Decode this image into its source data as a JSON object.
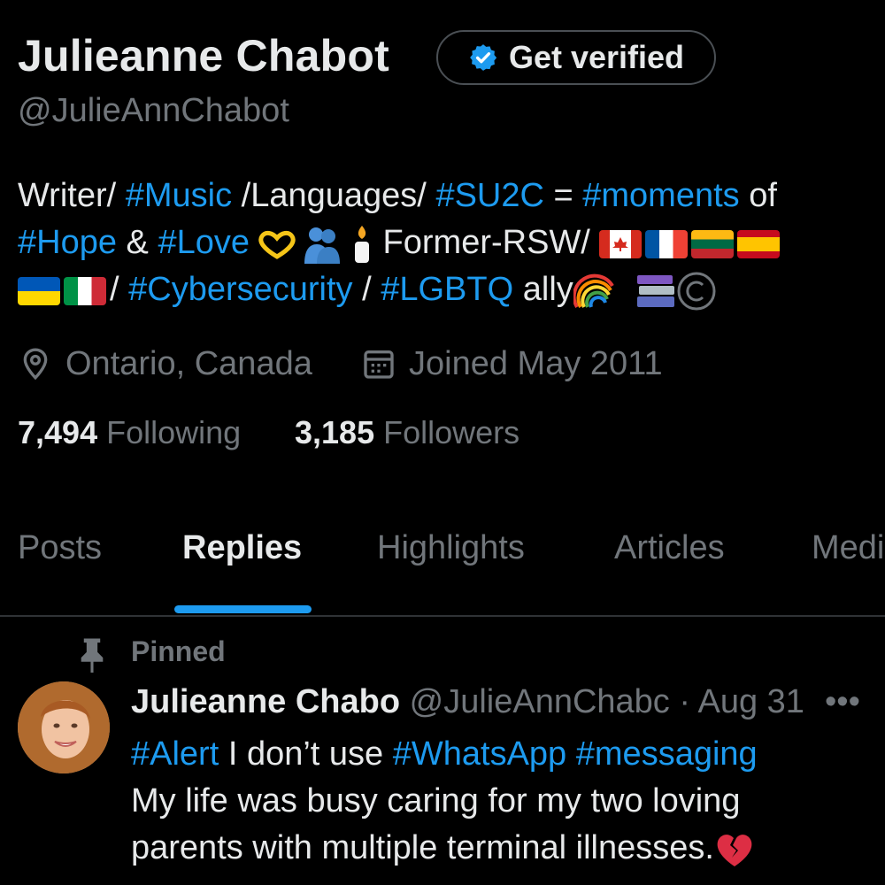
{
  "profile": {
    "name": "Julieanne Chabot",
    "handle": "@JulieAnnChabot",
    "get_verified_label": "Get verified",
    "bio": {
      "line1": {
        "t1": "Writer/ ",
        "tag1": "#Music",
        "t2": " /Languages/ ",
        "tag2": "#SU2C",
        "t3": " = ",
        "tag3": "#moments",
        "t4": " of"
      },
      "line2": {
        "tag1": "#Hope",
        "t1": " & ",
        "tag2": "#Love",
        "t2": " Former-RSW/ "
      },
      "line3": {
        "t1": "/ ",
        "tag1": "#Cybersecurity",
        "t2": " / ",
        "tag2": "#LGBTQ",
        "t3": " ally"
      }
    },
    "location": "Ontario, Canada",
    "joined": "Joined May 2011",
    "following_count": "7,494",
    "following_label": "Following",
    "followers_count": "3,185",
    "followers_label": "Followers"
  },
  "icons": {
    "verified": "verified-badge-icon",
    "location": "location-pin-icon",
    "calendar": "calendar-icon",
    "pin": "pin-icon",
    "more": "more-icon",
    "emoji": [
      "heart-hands-icon",
      "people-hugging-icon",
      "candle-icon",
      "rainbow-icon",
      "books-icon",
      "copyright-icon",
      "broken-heart-icon"
    ],
    "flags": [
      "canada-flag-icon",
      "france-flag-icon",
      "lithuania-flag-icon",
      "spain-flag-icon",
      "ukraine-flag-icon",
      "italy-flag-icon"
    ]
  },
  "tabs": [
    {
      "label": "Posts"
    },
    {
      "label": "Replies",
      "active": true
    },
    {
      "label": "Highlights"
    },
    {
      "label": "Articles"
    },
    {
      "label": "Medi"
    }
  ],
  "pinned_tweet": {
    "pinned_label": "Pinned",
    "author_name": "Julieanne Chabo",
    "author_handle": "@JulieAnnChabc",
    "separator": "·",
    "date": "Aug 31",
    "more_label": "•••",
    "text": {
      "l1": {
        "tag1": "#Alert",
        "t1": " I don’t use ",
        "tag2": "#WhatsApp",
        "t2": " ",
        "tag3": "#messaging"
      },
      "l2": "My life was busy caring for my two loving",
      "l3": "parents with multiple terminal illnesses."
    }
  },
  "colors": {
    "background": "#000000",
    "text": "#e7e9ea",
    "muted": "#71767b",
    "accent": "#1d9bf0",
    "divider": "#2f3336"
  }
}
